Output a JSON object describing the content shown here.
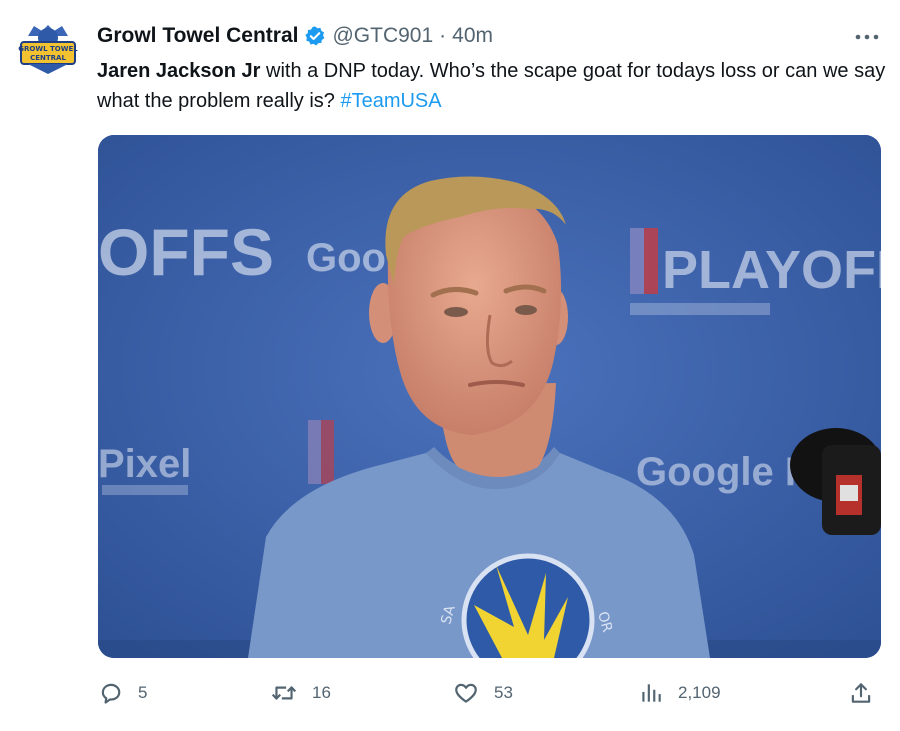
{
  "tweet": {
    "display_name": "Growl Towel Central",
    "handle": "@GTC901",
    "separator": "·",
    "time": "40m",
    "more_icon": "more-horizontal-icon",
    "verified_icon": "verified-badge-icon",
    "avatar_text": "GROWL TOWEL CENTRAL",
    "text": {
      "bold": "Jaren Jackson Jr",
      "body": " with a DNP today. Who’s the scape goat for todays loss or can we say what the problem really is? ",
      "hashtag": "#TeamUSA"
    },
    "media": {
      "backdrop_text_left": "OFFS",
      "backdrop_text_goog": "Goo",
      "backdrop_text_playoffs": "PLAYOFFS",
      "backdrop_text_pixel": "Pixel",
      "backdrop_text_google": "Google Pi"
    },
    "actions": {
      "replies": "5",
      "retweets": "16",
      "likes": "53",
      "views": "2,109"
    }
  },
  "colors": {
    "text": "#0f1419",
    "muted": "#536471",
    "accent": "#1d9bf0",
    "media_bg": "#3a5fa6"
  }
}
